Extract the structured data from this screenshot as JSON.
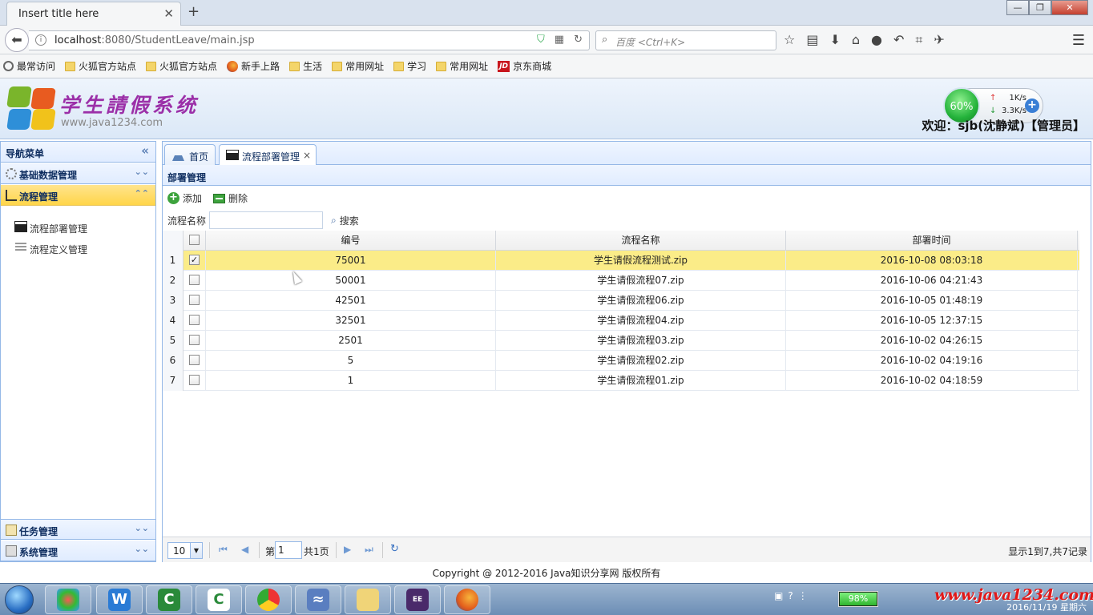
{
  "browser": {
    "tab_title": "Insert title here",
    "tab_close": "✕",
    "new_tab": "+",
    "url_host": "localhost",
    "url_rest": ":8080/StudentLeave/main.jsp",
    "search_placeholder": "百度 <Ctrl+K>",
    "window_buttons": [
      "—",
      "❐",
      "✕"
    ]
  },
  "bookmarks": [
    "最常访问",
    "火狐官方站点",
    "火狐官方站点",
    "新手上路",
    "生活",
    "常用网址",
    "学习",
    "常用网址",
    "京东商城"
  ],
  "app": {
    "title": "学生請假系统",
    "subtitle": "www.java1234.com",
    "welcome": "欢迎：sjb(沈静斌)【管理员】",
    "net": {
      "percent": "60%",
      "up": "1K/s",
      "down": "3.3K/s"
    }
  },
  "nav": {
    "title": "导航菜单",
    "sections": [
      {
        "label": "基础数据管理",
        "chevron": "⌄⌄"
      },
      {
        "label": "流程管理",
        "chevron": "⌃⌃"
      },
      {
        "label": "任务管理",
        "chevron": "⌄⌄"
      },
      {
        "label": "系统管理",
        "chevron": "⌄⌄"
      }
    ],
    "collapse": "«",
    "items": [
      {
        "label": "流程部署管理"
      },
      {
        "label": "流程定义管理"
      }
    ]
  },
  "tabs": [
    {
      "label": "首页"
    },
    {
      "label": "流程部署管理",
      "close": "×"
    }
  ],
  "panel": {
    "title": "部署管理",
    "add_label": "添加",
    "delete_label": "删除",
    "filter_label": "流程名称",
    "search_label": "搜索",
    "columns": [
      "编号",
      "流程名称",
      "部署时间"
    ],
    "rows": [
      {
        "num": "1",
        "checked": true,
        "id": "75001",
        "name": "学生请假流程测试.zip",
        "time": "2016-10-08 08:03:18"
      },
      {
        "num": "2",
        "checked": false,
        "id": "50001",
        "name": "学生请假流程07.zip",
        "time": "2016-10-06 04:21:43"
      },
      {
        "num": "3",
        "checked": false,
        "id": "42501",
        "name": "学生请假流程06.zip",
        "time": "2016-10-05 01:48:19"
      },
      {
        "num": "4",
        "checked": false,
        "id": "32501",
        "name": "学生请假流程04.zip",
        "time": "2016-10-05 12:37:15"
      },
      {
        "num": "5",
        "checked": false,
        "id": "2501",
        "name": "学生请假流程03.zip",
        "time": "2016-10-02 04:26:15"
      },
      {
        "num": "6",
        "checked": false,
        "id": "5",
        "name": "学生请假流程02.zip",
        "time": "2016-10-02 04:19:16"
      },
      {
        "num": "7",
        "checked": false,
        "id": "1",
        "name": "学生请假流程01.zip",
        "time": "2016-10-02 04:18:59"
      }
    ],
    "pager": {
      "page_size": "10",
      "page_prefix": "第",
      "page_value": "1",
      "page_total": "共1页",
      "info": "显示1到7,共7记录"
    }
  },
  "footer": "Copyright @ 2012-2016 Java知识分享网 版权所有",
  "taskbar": {
    "battery": "98%",
    "watermark": "www.java1234.com",
    "date": "2016/11/19 星期六"
  },
  "colors": {
    "selected_row": "#fbec88",
    "accent_border": "#95b8e7",
    "title_purple": "#9b2fa8"
  }
}
